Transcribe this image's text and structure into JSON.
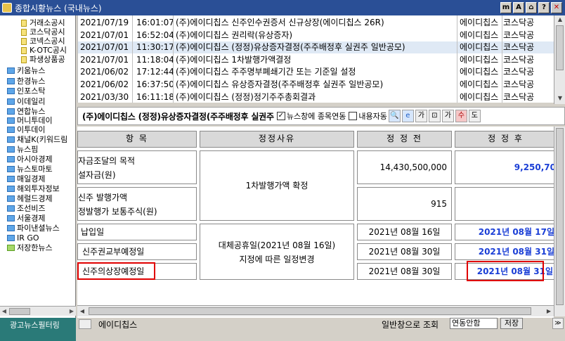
{
  "window": {
    "title": "종합시황뉴스 (국내뉴스)"
  },
  "tree": {
    "items": [
      {
        "label": "거래소공시",
        "type": "doc"
      },
      {
        "label": "코스닥공시",
        "type": "doc"
      },
      {
        "label": "코넥스공시",
        "type": "doc"
      },
      {
        "label": "K-OTC공시",
        "type": "doc"
      },
      {
        "label": "파생상품공",
        "type": "doc"
      },
      {
        "label": "키움뉴스",
        "type": "folder"
      },
      {
        "label": "한경뉴스",
        "type": "folder"
      },
      {
        "label": "인포스탁",
        "type": "folder"
      },
      {
        "label": "이데일리",
        "type": "folder"
      },
      {
        "label": "연합뉴스",
        "type": "folder"
      },
      {
        "label": "머니투데이",
        "type": "folder"
      },
      {
        "label": "이투데이",
        "type": "folder"
      },
      {
        "label": "채널K(키워드림",
        "type": "folder"
      },
      {
        "label": "뉴스핌",
        "type": "folder"
      },
      {
        "label": "아시아경제",
        "type": "folder"
      },
      {
        "label": "뉴스토마토",
        "type": "folder"
      },
      {
        "label": "매일경제",
        "type": "folder"
      },
      {
        "label": "해외투자정보",
        "type": "folder"
      },
      {
        "label": "헤럴드경제",
        "type": "folder"
      },
      {
        "label": "조선비즈",
        "type": "folder"
      },
      {
        "label": "서울경제",
        "type": "folder"
      },
      {
        "label": "파이낸셜뉴스",
        "type": "folder"
      },
      {
        "label": "IR GO",
        "type": "folder"
      },
      {
        "label": "저장한뉴스",
        "type": "open-folder"
      }
    ],
    "ad_label": "광고뉴스필터링"
  },
  "news_list": {
    "rows": [
      {
        "date": "2021/07/19",
        "time": "16:01:07",
        "title": "(주)에이디칩스 신주인수권증서 신규상장(에이디칩스 26R)",
        "company": "에이디칩스",
        "market": "코스닥공"
      },
      {
        "date": "2021/07/01",
        "time": "16:52:04",
        "title": "(주)에이디칩스 권리락(유상증자)",
        "company": "에이디칩스",
        "market": "코스닥공"
      },
      {
        "date": "2021/07/01",
        "time": "11:30:17",
        "title": "(주)에이디칩스 (정정)유상증자결정(주주배정후 실권주 일반공모)",
        "company": "에이디칩스",
        "market": "코스닥공",
        "selected": true
      },
      {
        "date": "2021/07/01",
        "time": "11:18:04",
        "title": "(주)에이디칩스 1차발행가액결정",
        "company": "에이디칩스",
        "market": "코스닥공"
      },
      {
        "date": "2021/06/02",
        "time": "17:12:44",
        "title": "(주)에이디칩스 주주명부폐쇄기간 또는 기준일 설정",
        "company": "에이디칩스",
        "market": "코스닥공"
      },
      {
        "date": "2021/06/02",
        "time": "16:37:50",
        "title": "(주)에이디칩스 유상증자결정(주주배정후 실권주 일반공모)",
        "company": "에이디칩스",
        "market": "코스닥공"
      },
      {
        "date": "2021/03/30",
        "time": "16:11:18",
        "title": "(주)에이디칩스 (정정)정기주주총회결과",
        "company": "에이디칩스",
        "market": "코스닥공"
      }
    ]
  },
  "detail_toolbar": {
    "headline": "(주)에이디칩스 (정정)유상증자결정(주주배정후 실권주",
    "news_link_label": "뉴스창에 종목연동",
    "auto_label": "내용자동",
    "icons": [
      "search-icon",
      "ie-icon",
      "font-smaller-icon",
      "fit-icon",
      "font-larger-icon",
      "upper-icon",
      "down-icon"
    ],
    "icon_glyphs": {
      "search": "🔍",
      "ie": "e",
      "font_smaller": "가",
      "fit": "⊡",
      "font_larger": "가",
      "upper": "수",
      "down": "도"
    }
  },
  "table": {
    "headers": [
      "항 목",
      "정정사유",
      "정 정 전",
      "정 정 후"
    ],
    "rows": [
      {
        "item": [
          "자금조달의 목적",
          "설자금(원)"
        ],
        "before": "14,430,500,000",
        "after": "9,250,70"
      },
      {
        "item": [
          "신주 발행가액",
          "정발행가 보통주식(원)"
        ],
        "before": "915",
        "after": ""
      },
      {
        "item": [
          "납입일"
        ],
        "before": "2021년 08월 16일",
        "after": "2021년 08월 17일"
      },
      {
        "item": [
          "신주권교부예정일"
        ],
        "before": "2021년 08월 30일",
        "after": "2021년 08월 31일"
      },
      {
        "item": [
          "신주의상장예정일"
        ],
        "before": "2021년 08월 30일",
        "after": "2021년 08월 31일"
      }
    ],
    "reason_1": "1차발행가액 확정",
    "reason_2": [
      "대체공휴일(2021년 08월 16일)",
      "지정에 따른 일정변경"
    ]
  },
  "status": {
    "company": "에이디칩스",
    "sort_label": "일반창으로 조회",
    "link_select": "연동안함",
    "save_button": "저장",
    "scroll_right_glyph": "▶",
    "corner_glyph": "≫"
  },
  "colors": {
    "title_bar": "#2a4f96",
    "highlight_red": "#e00000",
    "after_blue": "#1b3fd6",
    "selected_row": "#dfe9f5"
  }
}
